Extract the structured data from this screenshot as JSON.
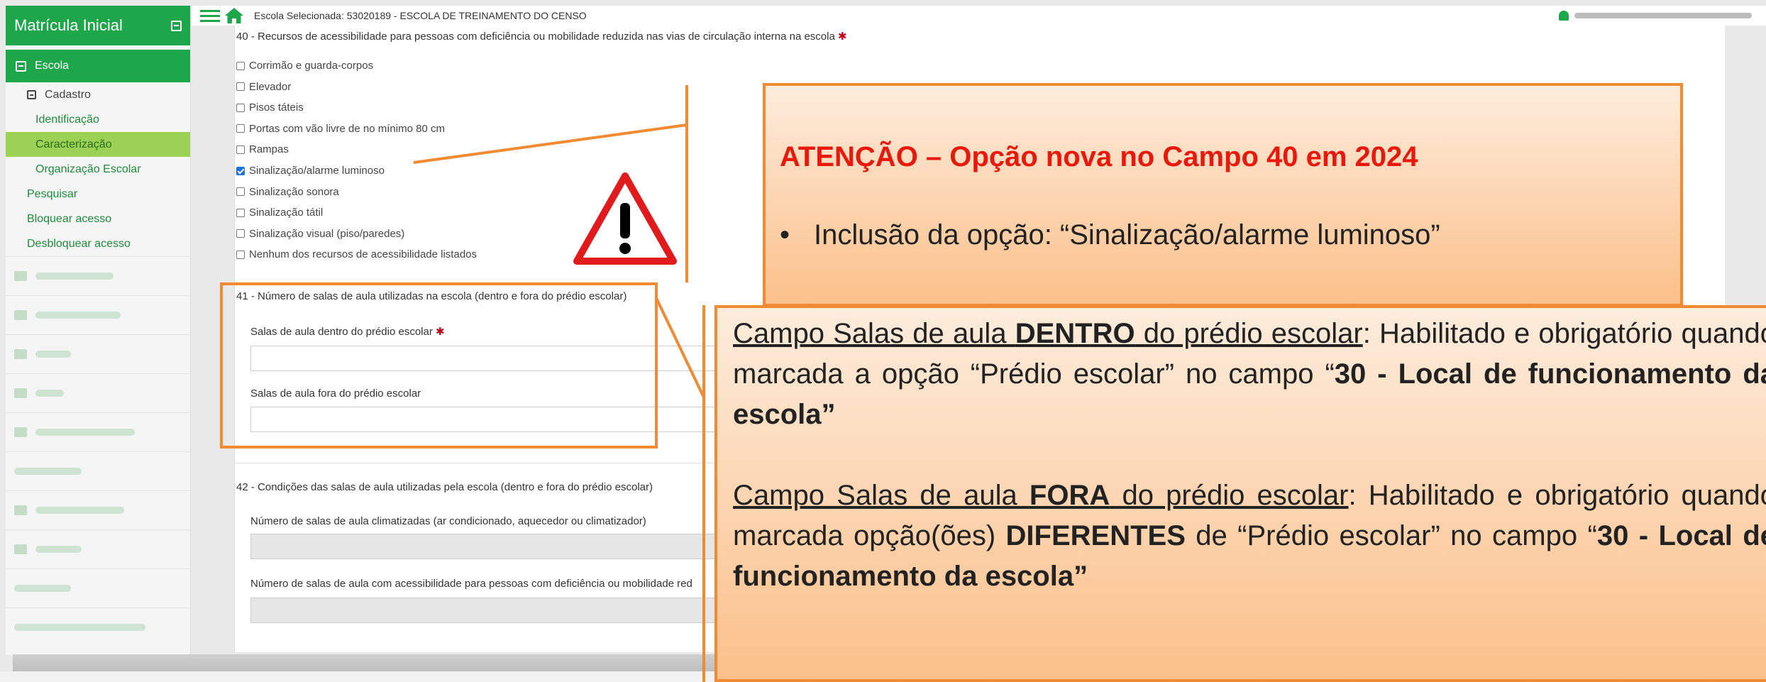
{
  "sidebar": {
    "title": "Matrícula Inicial",
    "escola": "Escola",
    "cadastro": "Cadastro",
    "items": [
      {
        "label": "Identificação"
      },
      {
        "label": "Caracterização"
      },
      {
        "label": "Organização Escolar"
      }
    ],
    "links": [
      {
        "label": "Pesquisar"
      },
      {
        "label": "Bloquear acesso"
      },
      {
        "label": "Desbloquear acesso"
      }
    ]
  },
  "topbar": {
    "school": "Escola Selecionada: 53020189 - ESCOLA DE TREINAMENTO DO CENSO"
  },
  "form": {
    "q40": "40 - Recursos de acessibilidade para pessoas com deficiência ou mobilidade reduzida nas vias de circulação interna na escola",
    "q40_required": "✱",
    "options": [
      {
        "label": "Corrimão e guarda-corpos",
        "checked": false
      },
      {
        "label": "Elevador",
        "checked": false
      },
      {
        "label": "Pisos táteis",
        "checked": false
      },
      {
        "label": "Portas com vão livre de no mínimo 80 cm",
        "checked": false
      },
      {
        "label": "Rampas",
        "checked": false
      },
      {
        "label": "Sinalização/alarme luminoso",
        "checked": true
      },
      {
        "label": "Sinalização sonora",
        "checked": false
      },
      {
        "label": "Sinalização tátil",
        "checked": false
      },
      {
        "label": "Sinalização visual (piso/paredes)",
        "checked": false
      },
      {
        "label": "Nenhum dos recursos de acessibilidade listados",
        "checked": false
      }
    ],
    "q41": "41 - Número de salas de aula utilizadas na escola (dentro e fora do prédio escolar)",
    "q41_f1": "Salas de aula dentro do prédio escolar",
    "q41_f1_required": "✱",
    "q41_f2": "Salas de aula fora do prédio escolar",
    "q42": "42 - Condições das salas de aula utilizadas pela escola (dentro e fora do prédio escolar)",
    "q42_f1": "Número de salas de aula climatizadas (ar condicionado, aquecedor ou climatizador)",
    "q42_f2": "Número de salas de aula com acessibilidade para pessoas com deficiência ou mobilidade red"
  },
  "callout1": {
    "heading": "ATENÇÃO – Opção nova no Campo 40 em 2024",
    "bullet": "•",
    "text": "Inclusão da opção: “Sinalização/alarme luminoso”"
  },
  "callout2": {
    "p1_a": "Campo Salas de aula ",
    "p1_b": "DENTRO",
    "p1_c": " do prédio escolar",
    "p1_d": ": Habilitado e obrigatório quando marcada a opção “Prédio escolar” no campo “",
    "p1_e": "30 - Local de funcionamento da escola”",
    "p2_a": "Campo Salas de aula ",
    "p2_b": "FORA",
    "p2_c": " do prédio escolar",
    "p2_d": ": Habilitado e obrigatório quando marcada  opção(ões) ",
    "p2_e": "DIFERENTES",
    "p2_f": " de “Prédio escolar” no campo “",
    "p2_g": "30 - Local de funcionamento da escola”"
  },
  "colors": {
    "brand_green": "#1ea64a",
    "active_green": "#9bd255",
    "callout_border": "#f08a33",
    "alert_red": "#e8190c"
  }
}
